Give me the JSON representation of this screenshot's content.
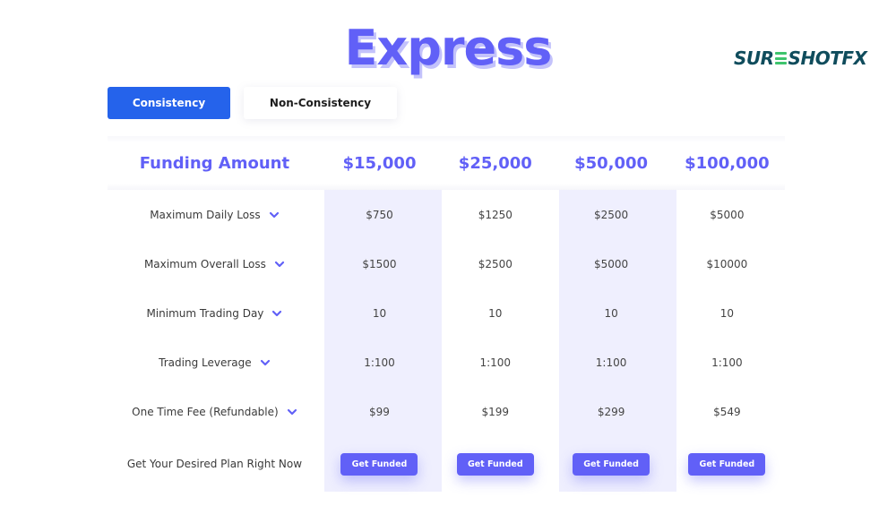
{
  "title": "Express",
  "brand": {
    "logo_prefix": "SUR",
    "logo_suffix": "SHOTFX",
    "accent_color": "#6160f7",
    "tab_active_color": "#2563eb",
    "logo_color": "#0f4c5c",
    "logo_green": "#3ec46d"
  },
  "tabs": [
    {
      "label": "Consistency",
      "active": true
    },
    {
      "label": "Non-Consistency",
      "active": false
    }
  ],
  "table": {
    "header_label": "Funding Amount",
    "columns": [
      "$15,000",
      "$25,000",
      "$50,000",
      "$100,000"
    ],
    "rows": [
      {
        "label": "Maximum Daily Loss",
        "icon": "chevron-down-icon",
        "values": [
          "$750",
          "$1250",
          "$2500",
          "$5000"
        ]
      },
      {
        "label": "Maximum Overall Loss",
        "icon": "chevron-down-icon",
        "values": [
          "$1500",
          "$2500",
          "$5000",
          "$10000"
        ]
      },
      {
        "label": "Minimum Trading Day",
        "icon": "chevron-down-icon",
        "values": [
          "10",
          "10",
          "10",
          "10"
        ]
      },
      {
        "label": "Trading Leverage",
        "icon": "chevron-down-icon",
        "values": [
          "1:100",
          "1:100",
          "1:100",
          "1:100"
        ]
      },
      {
        "label": "One Time Fee (Refundable)",
        "icon": "chevron-down-icon",
        "values": [
          "$99",
          "$199",
          "$299",
          "$549"
        ]
      }
    ],
    "cta_label": "Get Your Desired Plan Right Now",
    "cta_button": "Get Funded"
  }
}
